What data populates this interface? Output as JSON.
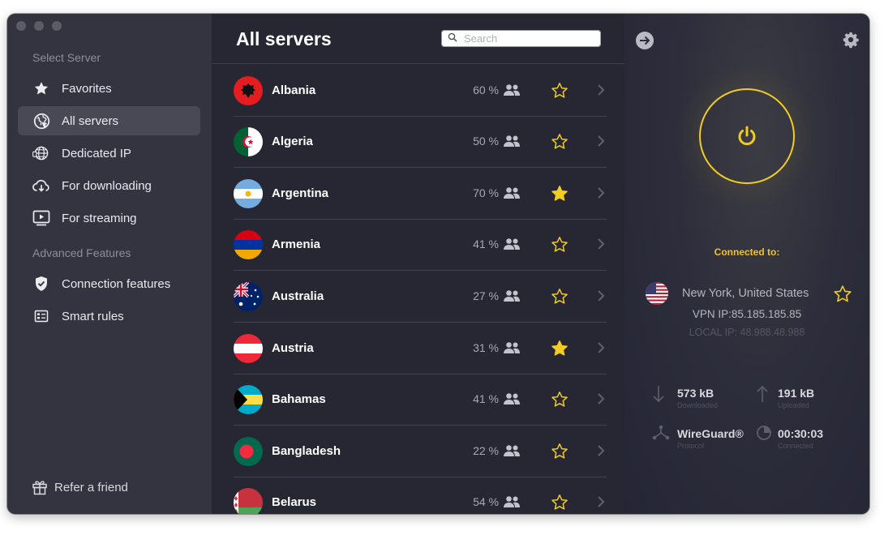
{
  "sidebar": {
    "section_select": "Select Server",
    "section_advanced": "Advanced Features",
    "items": [
      {
        "label": "Favorites",
        "icon": "star-icon"
      },
      {
        "label": "All servers",
        "icon": "globe-icon"
      },
      {
        "label": "Dedicated IP",
        "icon": "dedicated-ip-icon"
      },
      {
        "label": "For downloading",
        "icon": "cloud-download-icon"
      },
      {
        "label": "For streaming",
        "icon": "streaming-icon"
      }
    ],
    "advanced_items": [
      {
        "label": "Connection features",
        "icon": "shield-check-icon"
      },
      {
        "label": "Smart rules",
        "icon": "smart-rules-icon"
      }
    ],
    "refer": "Refer a friend"
  },
  "list": {
    "title": "All servers",
    "search_placeholder": "Search",
    "servers": [
      {
        "country": "Albania",
        "load": "60 %",
        "favorite": false
      },
      {
        "country": "Algeria",
        "load": "50 %",
        "favorite": false
      },
      {
        "country": "Argentina",
        "load": "70 %",
        "favorite": true
      },
      {
        "country": "Armenia",
        "load": "41 %",
        "favorite": false
      },
      {
        "country": "Australia",
        "load": "27 %",
        "favorite": false
      },
      {
        "country": "Austria",
        "load": "31 %",
        "favorite": true
      },
      {
        "country": "Bahamas",
        "load": "41 %",
        "favorite": false
      },
      {
        "country": "Bangladesh",
        "load": "22 %",
        "favorite": false
      },
      {
        "country": "Belarus",
        "load": "54 %",
        "favorite": false
      }
    ]
  },
  "connection": {
    "label": "Connected to:",
    "location": "New York, United States",
    "vpn_ip": "VPN IP:85.185.185.85",
    "local_ip": "LOCAL IP: 48.988.48.988",
    "downloaded": "573 kB",
    "downloaded_label": "Downloaded",
    "uploaded": "191 kB",
    "uploaded_label": "Uploaded",
    "protocol": "WireGuard®",
    "protocol_label": "Protocol",
    "connected_time": "00:30:03",
    "connected_label": "Connected"
  },
  "colors": {
    "accent": "#f2cc21",
    "background": "#262733",
    "sidebar": "#33343f"
  }
}
